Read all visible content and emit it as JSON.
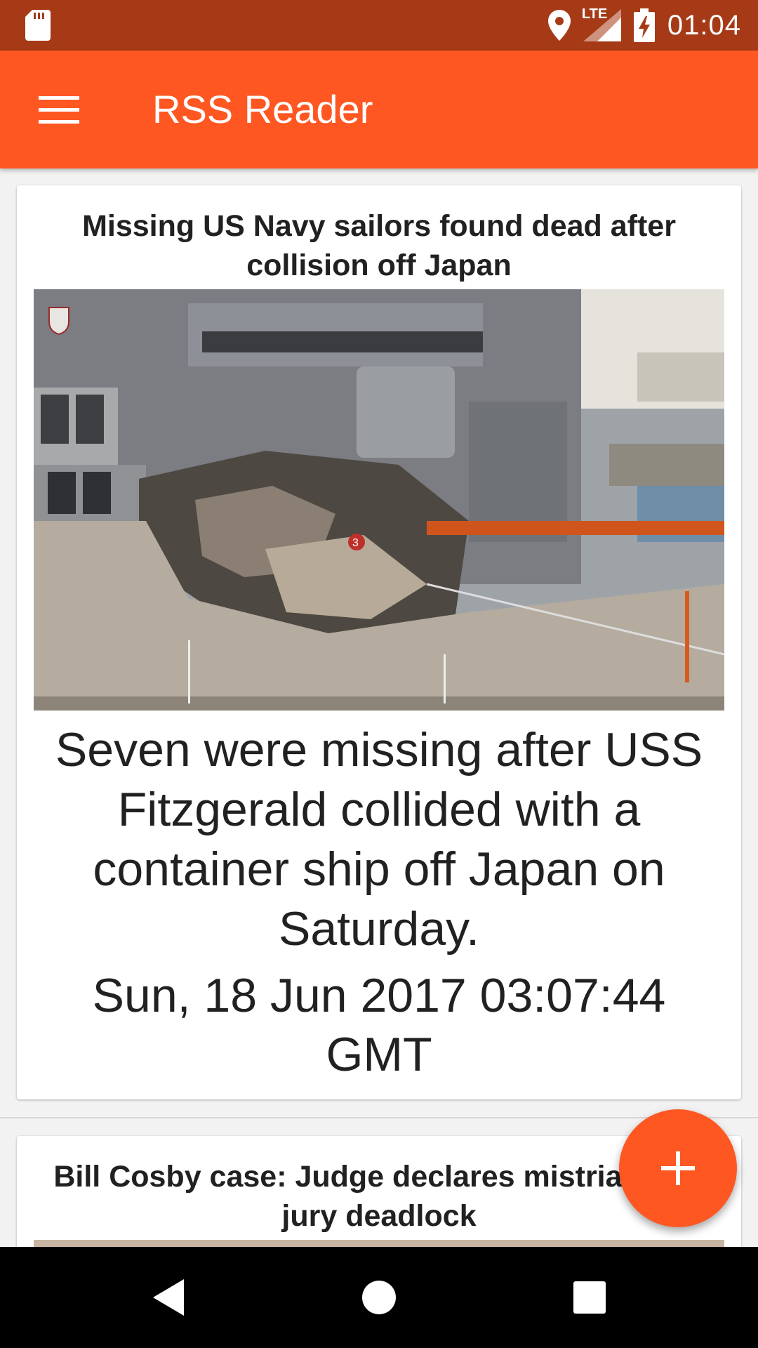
{
  "status_bar": {
    "time": "01:04",
    "network_label": "LTE",
    "icons": [
      "sd-card-icon",
      "location-icon",
      "signal-icon",
      "battery-charging-icon"
    ]
  },
  "app_bar": {
    "title": "RSS Reader",
    "menu_icon": "hamburger-menu-icon"
  },
  "articles": [
    {
      "title": "Missing US Navy sailors found dead after collision off Japan",
      "image_label": "3",
      "description": "Seven were missing after USS Fitzgerald collided with a container ship off Japan on Saturday.",
      "date": "Sun, 18 Jun 2017 03:07:44 GMT"
    },
    {
      "title": "Bill Cosby case: Judge declares mistrial after jury deadlock"
    }
  ],
  "fab": {
    "icon": "plus-icon"
  },
  "nav_bar": {
    "icons": [
      "back-icon",
      "home-icon",
      "recents-icon"
    ]
  },
  "colors": {
    "status_bar": "#a63a16",
    "app_bar": "#fe5722",
    "fab": "#fe5722",
    "background": "#f2f2f2",
    "text": "#212121"
  }
}
